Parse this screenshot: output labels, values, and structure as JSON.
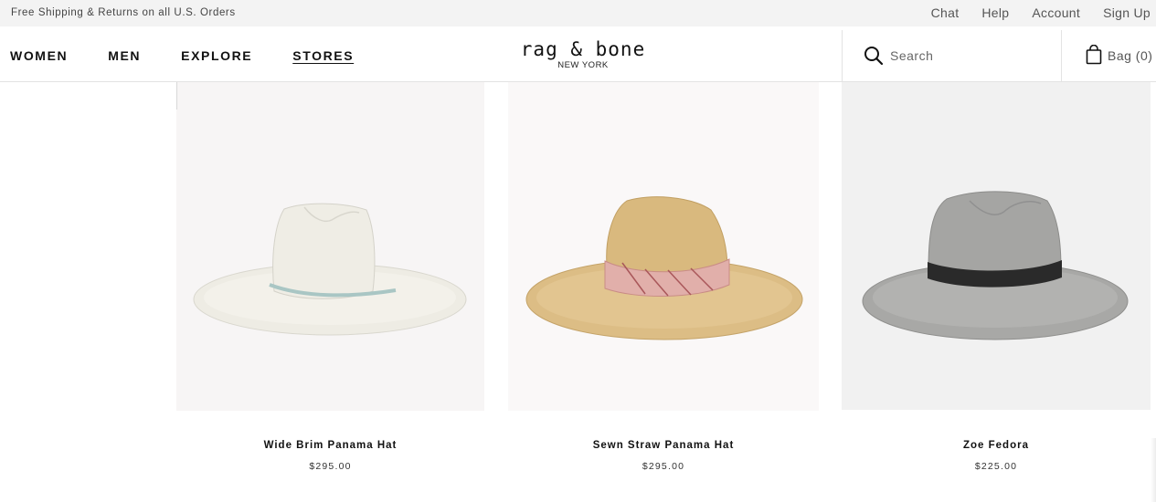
{
  "promo": {
    "text": "Free Shipping & Returns on all U.S. Orders"
  },
  "utility": {
    "links": [
      {
        "label": "Chat"
      },
      {
        "label": "Help"
      },
      {
        "label": "Account"
      },
      {
        "label": "Sign Up"
      }
    ]
  },
  "nav": {
    "items": [
      {
        "label": "WOMEN"
      },
      {
        "label": "MEN"
      },
      {
        "label": "EXPLORE"
      },
      {
        "label": "STORES"
      }
    ]
  },
  "logo": {
    "main": "rag & bone",
    "sub": "NEW YORK"
  },
  "search": {
    "placeholder": "Search",
    "icon": "search-icon"
  },
  "bag": {
    "label": "Bag (0)",
    "icon": "shopping-bag-icon"
  },
  "products": [
    {
      "name": "Wide Brim Panama Hat",
      "price": "$295.00",
      "colors": {
        "hat": "#eeece4",
        "band": "#a9c6c4",
        "bg": "#f7f5f5"
      }
    },
    {
      "name": "Sewn Straw Panama Hat",
      "price": "$295.00",
      "colors": {
        "hat": "#dcbd85",
        "band": "#e1afaa",
        "bg": "#faf8f8"
      }
    },
    {
      "name": "Zoe Fedora",
      "price": "$225.00",
      "colors": {
        "hat": "#a8a8a6",
        "band": "#2a2a2a",
        "bg": "#f1f1f1"
      }
    }
  ]
}
